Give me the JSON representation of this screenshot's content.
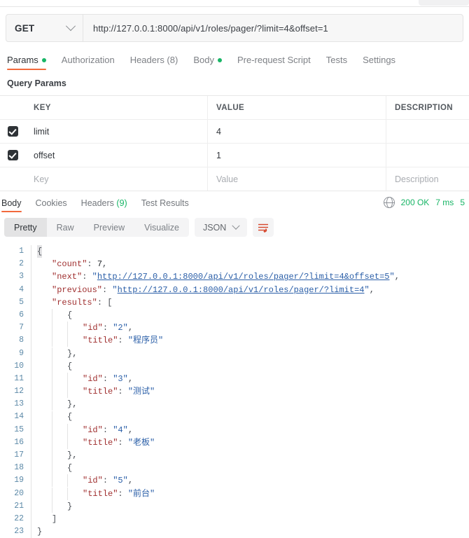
{
  "request": {
    "method": "GET",
    "url": "http://127.0.0.1:8000/api/v1/roles/pager/?limit=4&offset=1",
    "tabs": [
      {
        "label": "Params",
        "dot": true,
        "active": true
      },
      {
        "label": "Authorization",
        "dot": false,
        "active": false
      },
      {
        "label": "Headers (8)",
        "dot": false,
        "active": false
      },
      {
        "label": "Body",
        "dot": true,
        "active": false
      },
      {
        "label": "Pre-request Script",
        "dot": false,
        "active": false
      },
      {
        "label": "Tests",
        "dot": false,
        "active": false
      },
      {
        "label": "Settings",
        "dot": false,
        "active": false
      }
    ],
    "section_title": "Query Params",
    "table": {
      "headers": [
        "KEY",
        "VALUE",
        "DESCRIPTION"
      ],
      "rows": [
        {
          "checked": true,
          "key": "limit",
          "value": "4",
          "description": ""
        },
        {
          "checked": true,
          "key": "offset",
          "value": "1",
          "description": ""
        }
      ],
      "placeholder_row": {
        "key": "Key",
        "value": "Value",
        "description": "Description"
      }
    }
  },
  "response": {
    "tabs": [
      {
        "label": "Body",
        "active": true
      },
      {
        "label": "Cookies",
        "active": false
      },
      {
        "label": "Headers",
        "count": "(9)",
        "active": false
      },
      {
        "label": "Test Results",
        "active": false
      }
    ],
    "status": {
      "code": "200 OK",
      "time": "7 ms",
      "size": "5"
    },
    "toolbar": {
      "views": [
        {
          "label": "Pretty",
          "active": true
        },
        {
          "label": "Raw",
          "active": false
        },
        {
          "label": "Preview",
          "active": false
        },
        {
          "label": "Visualize",
          "active": false
        }
      ],
      "format": "JSON"
    },
    "body_json": {
      "count": 7,
      "next": "http://127.0.0.1:8000/api/v1/roles/pager/?limit=4&offset=5",
      "previous": "http://127.0.0.1:8000/api/v1/roles/pager/?limit=4",
      "results": [
        {
          "id": "2",
          "title": "程序员"
        },
        {
          "id": "3",
          "title": "测试"
        },
        {
          "id": "4",
          "title": "老板"
        },
        {
          "id": "5",
          "title": "前台"
        }
      ]
    },
    "lines": [
      {
        "n": "1",
        "indent": 0,
        "html": "brace_open_hl"
      },
      {
        "n": "2",
        "indent": 1,
        "key": "count",
        "val": "7",
        "type": "num",
        "comma": true
      },
      {
        "n": "3",
        "indent": 1,
        "key": "next",
        "val": "http://127.0.0.1:8000/api/v1/roles/pager/?limit=4&offset=5",
        "type": "link",
        "comma": true
      },
      {
        "n": "4",
        "indent": 1,
        "key": "previous",
        "val": "http://127.0.0.1:8000/api/v1/roles/pager/?limit=4",
        "type": "link",
        "comma": true
      },
      {
        "n": "5",
        "indent": 1,
        "key": "results",
        "val": "[",
        "type": "open",
        "comma": false
      },
      {
        "n": "6",
        "indent": 2,
        "punct": "{"
      },
      {
        "n": "7",
        "indent": 3,
        "key": "id",
        "val": "2",
        "type": "str",
        "comma": true
      },
      {
        "n": "8",
        "indent": 3,
        "key": "title",
        "val": "程序员",
        "type": "str",
        "comma": false
      },
      {
        "n": "9",
        "indent": 2,
        "punct": "},"
      },
      {
        "n": "10",
        "indent": 2,
        "punct": "{"
      },
      {
        "n": "11",
        "indent": 3,
        "key": "id",
        "val": "3",
        "type": "str",
        "comma": true
      },
      {
        "n": "12",
        "indent": 3,
        "key": "title",
        "val": "测试",
        "type": "str",
        "comma": false
      },
      {
        "n": "13",
        "indent": 2,
        "punct": "},"
      },
      {
        "n": "14",
        "indent": 2,
        "punct": "{"
      },
      {
        "n": "15",
        "indent": 3,
        "key": "id",
        "val": "4",
        "type": "str",
        "comma": true
      },
      {
        "n": "16",
        "indent": 3,
        "key": "title",
        "val": "老板",
        "type": "str",
        "comma": false
      },
      {
        "n": "17",
        "indent": 2,
        "punct": "},"
      },
      {
        "n": "18",
        "indent": 2,
        "punct": "{"
      },
      {
        "n": "19",
        "indent": 3,
        "key": "id",
        "val": "5",
        "type": "str",
        "comma": true
      },
      {
        "n": "20",
        "indent": 3,
        "key": "title",
        "val": "前台",
        "type": "str",
        "comma": false
      },
      {
        "n": "21",
        "indent": 2,
        "punct": "}"
      },
      {
        "n": "22",
        "indent": 1,
        "punct": "]"
      },
      {
        "n": "23",
        "indent": 0,
        "punct": "}"
      }
    ]
  },
  "colors": {
    "accent": "#f2693c",
    "green": "#18b566",
    "key": "#a03030",
    "string": "#2b5fa8",
    "linenum": "#5d8aa8"
  }
}
